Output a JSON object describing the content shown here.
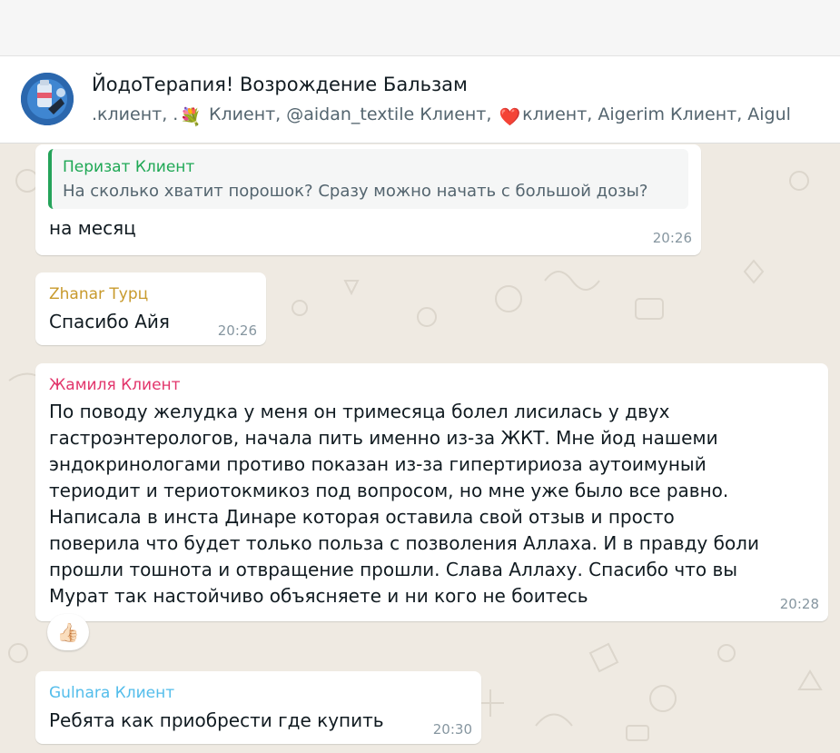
{
  "header": {
    "title": "ЙодоТерапия! Возрождение Бальзам",
    "participants": [
      {
        "text": ".клиент, ."
      },
      {
        "icon": "flower-emoji",
        "glyph": "💐"
      },
      {
        "text": " Клиент, @aidan_textile Клиент, "
      },
      {
        "icon": "heart-emoji",
        "glyph": "❤️"
      },
      {
        "text": "клиент, Aigerim Клиент, Aigul"
      }
    ]
  },
  "messages": [
    {
      "quote": {
        "sender": "Перизат Клиент",
        "text": "На сколько хватит порошок? Сразу можно начать с большой дозы?"
      },
      "lines": [
        "на месяц"
      ],
      "time": "20:26"
    },
    {
      "sender": "Zhanar Турц",
      "sender_color": "#c89a2c",
      "lines": [
        "Спасибо Айя"
      ],
      "time": "20:26"
    },
    {
      "sender": "Жамиля Клиент",
      "sender_color": "#e2356b",
      "lines": [
        "По поводу желудка у меня он тримесяца болел лисилась у двух",
        "гастроэнтерологов, начала пить именно из-за ЖКТ. Мне йод нашеми",
        "эндокринологами противо показан из-за гипертириоза аутоимуный",
        "териодит и териотокмикоз под вопросом,  но мне уже было все равно.",
        "Написала в инста Динаре которая оставила свой отзыв и просто",
        "поверила что будет только польза с позволения Аллаха. И в правду боли",
        "прошли   тошнота и отвращение прошли. Слава Аллаху.  Спасибо что вы",
        "Мурат так настойчиво объясняете   и ни кого не боитесь"
      ],
      "time": "20:28",
      "reaction": {
        "icon": "thumbs-up-emoji",
        "glyph": "👍🏻"
      }
    },
    {
      "sender": "Gulnara Клиент",
      "sender_color": "#53bdeb",
      "lines": [
        "Ребята как приобрести где купить"
      ],
      "time": "20:30"
    }
  ],
  "colors": {
    "chat_background": "#efeae2",
    "bubble": "#ffffff",
    "quote_bar": "#25a35a",
    "timestamp": "#8696a0"
  }
}
